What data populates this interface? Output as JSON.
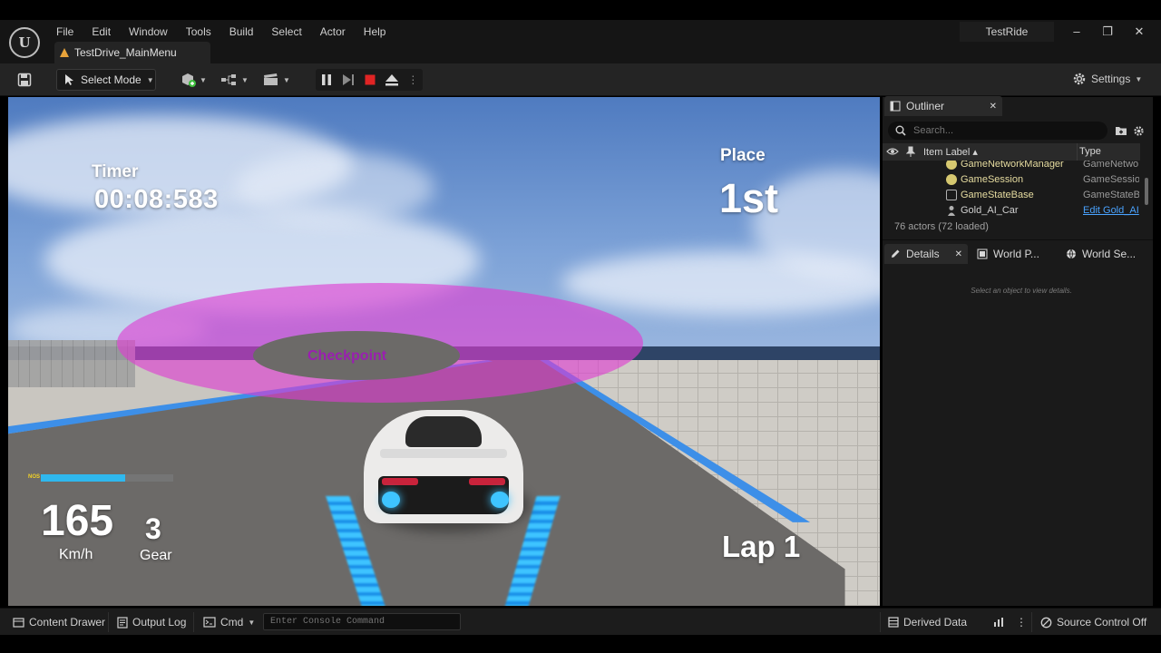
{
  "menu": [
    "File",
    "Edit",
    "Window",
    "Tools",
    "Build",
    "Select",
    "Actor",
    "Help"
  ],
  "document_tab": "TestDrive_MainMenu",
  "project_name": "TestRide",
  "window_controls": {
    "minimize": "–",
    "maximize": "❐",
    "close": "✕"
  },
  "toolbar": {
    "select_mode": "Select Mode",
    "settings": "Settings"
  },
  "hud": {
    "timer_label": "Timer",
    "timer_value": "00:08:583",
    "place_label": "Place",
    "place_value": "1st",
    "lap": "Lap 1",
    "nos_label": "NOS",
    "nos_fraction": 0.64,
    "speed": "165",
    "speed_unit": "Km/h",
    "gear": "3",
    "gear_label": "Gear",
    "checkpoint": "Checkpoint"
  },
  "outliner": {
    "tab": "Outliner",
    "search_placeholder": "Search...",
    "columns": {
      "label": "Item Label ▴",
      "type": "Type"
    },
    "rows": [
      {
        "label": "GameNetworkManager",
        "type": "GameNetwo",
        "icon_color": "#d6c870"
      },
      {
        "label": "GameSession",
        "type": "GameSessio",
        "icon_color": "#d6c870"
      },
      {
        "label": "GameStateBase",
        "type": "GameStateB",
        "icon_color": "#b0b0b0"
      },
      {
        "label": "Gold_AI_Car",
        "type": "Edit Gold_AI",
        "icon_color": "#b0b0b0"
      }
    ],
    "actors_count": "76 actors (72 loaded)"
  },
  "details": {
    "tabs": [
      "Details",
      "World P...",
      "World Se..."
    ],
    "hint": "Select an object to view details."
  },
  "statusbar": {
    "content_drawer": "Content Drawer",
    "output_log": "Output Log",
    "cmd": "Cmd",
    "console_placeholder": "Enter Console Command",
    "derived_data": "Derived Data",
    "source_control": "Source Control Off"
  },
  "colors": {
    "accent_link": "#4aa3ff",
    "checkpoint_ring": "#de3cd2",
    "nos_fill": "#2fb8ee",
    "stop_button": "#e02424"
  }
}
